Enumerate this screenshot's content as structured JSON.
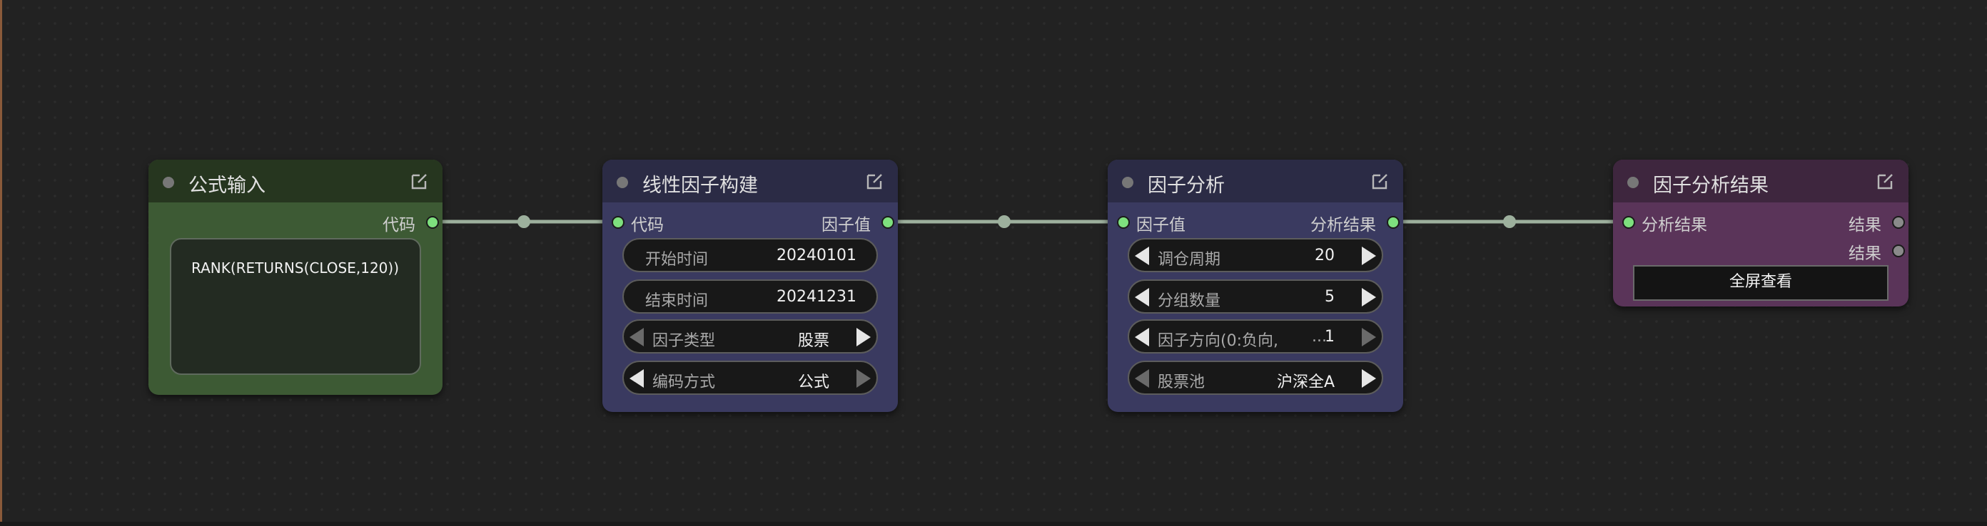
{
  "colors": {
    "canvas": "#222222",
    "link": "#9db09d",
    "slot_active": "#7ee07e",
    "slot_idle": "#8a8a8a",
    "formula_node_body": "#3d5a34",
    "formula_node_title": "#26361f",
    "blue_node_body": "#3a3a60",
    "blue_node_title": "#2b2b45",
    "purple_node_body": "#5a3459",
    "purple_node_title": "#3e263e"
  },
  "nodes": {
    "formula_input": {
      "title": "公式输入",
      "output_label": "代码",
      "formula": "RANK(RETURNS(CLOSE,120))",
      "icon": "edit-icon"
    },
    "linear_factor": {
      "title": "线性因子构建",
      "input_label": "代码",
      "output_label": "因子值",
      "icon": "edit-icon",
      "start_label": "开始时间",
      "start_value": "20240101",
      "end_label": "结束时间",
      "end_value": "20241231",
      "type_label": "因子类型",
      "type_value": "股票",
      "encoding_label": "编码方式",
      "encoding_value": "公式"
    },
    "factor_analysis": {
      "title": "因子分析",
      "input_label": "因子值",
      "output_label": "分析结果",
      "icon": "edit-icon",
      "rebalance_label": "调仓周期",
      "rebalance_value": "20",
      "groups_label": "分组数量",
      "groups_value": "5",
      "direction_label": "因子方向(0:负向,",
      "direction_ellipsis": "...",
      "direction_value": "1",
      "pool_label": "股票池",
      "pool_value": "沪深全A"
    },
    "analysis_result": {
      "title": "因子分析结果",
      "input_label": "分析结果",
      "output1_label": "结果",
      "output2_label": "结果",
      "fullscreen_label": "全屏查看",
      "icon": "edit-icon"
    }
  }
}
